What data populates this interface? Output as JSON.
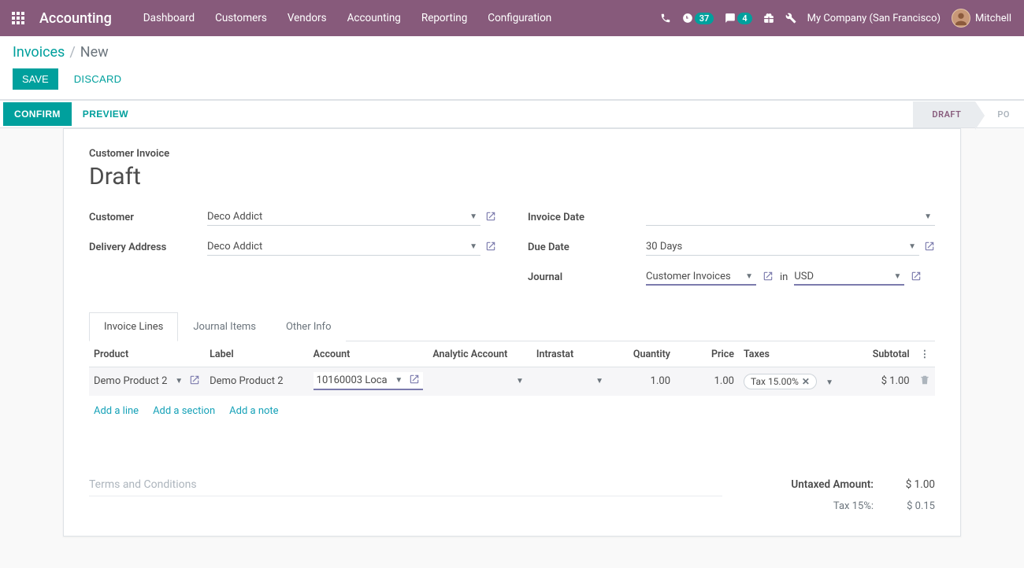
{
  "navbar": {
    "brand": "Accounting",
    "menu": [
      "Dashboard",
      "Customers",
      "Vendors",
      "Accounting",
      "Reporting",
      "Configuration"
    ],
    "activities_badge": "37",
    "discuss_badge": "4",
    "company": "My Company (San Francisco)",
    "user": "Mitchell"
  },
  "breadcrumb": {
    "parent": "Invoices",
    "current": "New"
  },
  "buttons": {
    "save": "SAVE",
    "discard": "DISCARD",
    "confirm": "CONFIRM",
    "preview": "PREVIEW"
  },
  "status": {
    "draft": "DRAFT",
    "posted": "PO"
  },
  "form": {
    "title_small": "Customer Invoice",
    "title": "Draft",
    "labels": {
      "customer": "Customer",
      "delivery_address": "Delivery Address",
      "invoice_date": "Invoice Date",
      "due_date": "Due Date",
      "journal": "Journal",
      "in": "in"
    },
    "values": {
      "customer": "Deco Addict",
      "delivery_address": "Deco Addict",
      "invoice_date": "",
      "due_date": "30 Days",
      "journal": "Customer Invoices",
      "currency": "USD"
    }
  },
  "tabs": [
    "Invoice Lines",
    "Journal Items",
    "Other Info"
  ],
  "columns": {
    "product": "Product",
    "label": "Label",
    "account": "Account",
    "analytic": "Analytic Account",
    "intrastat": "Intrastat",
    "quantity": "Quantity",
    "price": "Price",
    "taxes": "Taxes",
    "subtotal": "Subtotal"
  },
  "line": {
    "product": "Demo Product 2",
    "label": "Demo Product 2",
    "account": "10160003 Loca",
    "quantity": "1.00",
    "price": "1.00",
    "tax": "Tax 15.00%",
    "subtotal": "$ 1.00"
  },
  "add_links": {
    "line": "Add a line",
    "section": "Add a section",
    "note": "Add a note"
  },
  "footer": {
    "terms_placeholder": "Terms and Conditions",
    "untaxed_label": "Untaxed Amount:",
    "untaxed_value": "$ 1.00",
    "tax_label": "Tax 15%:",
    "tax_value": "$ 0.15"
  }
}
